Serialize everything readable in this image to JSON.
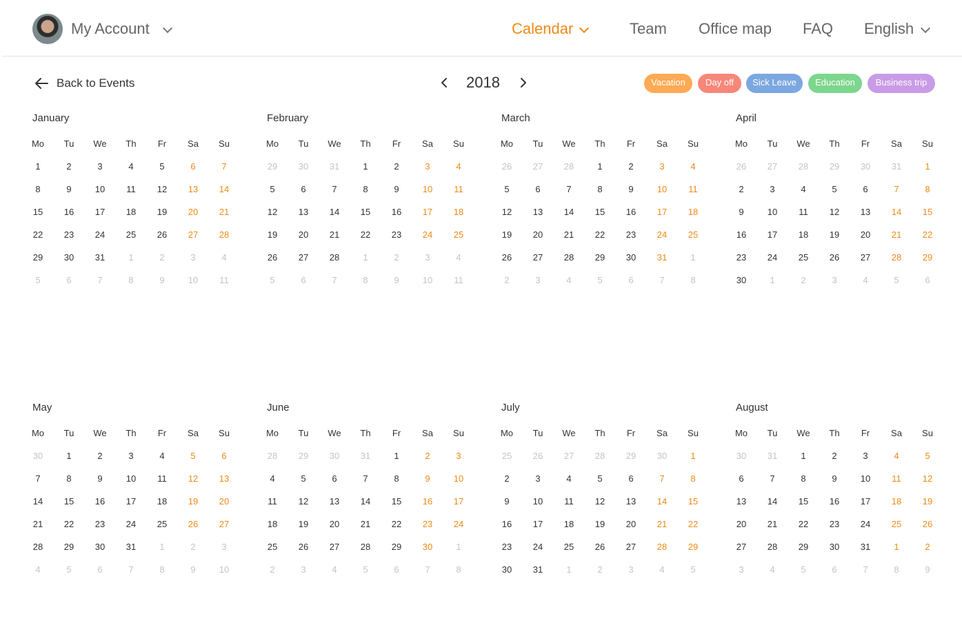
{
  "header": {
    "account_label": "My Account",
    "nav": [
      "Calendar",
      "Team",
      "Office map",
      "FAQ",
      "English"
    ],
    "active": "Calendar",
    "accent_color": "#ef8a17"
  },
  "toolbar": {
    "back_label": "Back to Events",
    "year": "2018"
  },
  "legend": [
    {
      "label": "Vacation",
      "color": "#ffaa55"
    },
    {
      "label": "Day off",
      "color": "#f7877a"
    },
    {
      "label": "Sick Leave",
      "color": "#7ba8e0"
    },
    {
      "label": "Education",
      "color": "#7dd68d"
    },
    {
      "label": "Business trip",
      "color": "#c99be6"
    }
  ],
  "weekdays": [
    "Mo",
    "Tu",
    "We",
    "Th",
    "Fr",
    "Sa",
    "Su"
  ],
  "months": [
    {
      "name": "January",
      "days": [
        1,
        2,
        3,
        4,
        5,
        6,
        7,
        8,
        9,
        10,
        11,
        12,
        13,
        14,
        15,
        16,
        17,
        18,
        19,
        20,
        21,
        22,
        23,
        24,
        25,
        26,
        27,
        28,
        29,
        30,
        31,
        1,
        2,
        3,
        4,
        5,
        6,
        7,
        8,
        9,
        10,
        11
      ],
      "lead_muted": 0,
      "trail_muted": 11
    },
    {
      "name": "February",
      "days": [
        29,
        30,
        31,
        1,
        2,
        3,
        4,
        5,
        6,
        7,
        8,
        9,
        10,
        11,
        12,
        13,
        14,
        15,
        16,
        17,
        18,
        19,
        20,
        21,
        22,
        23,
        24,
        25,
        26,
        27,
        28,
        1,
        2,
        3,
        4,
        5,
        6,
        7,
        8,
        9,
        10,
        11
      ],
      "lead_muted": 3,
      "trail_muted": 11
    },
    {
      "name": "March",
      "days": [
        26,
        27,
        28,
        1,
        2,
        3,
        4,
        5,
        6,
        7,
        8,
        9,
        10,
        11,
        12,
        13,
        14,
        15,
        16,
        17,
        18,
        19,
        20,
        21,
        22,
        23,
        24,
        25,
        26,
        27,
        28,
        29,
        30,
        31,
        1,
        2,
        3,
        4,
        5,
        6,
        7,
        8
      ],
      "lead_muted": 3,
      "trail_muted": 8
    },
    {
      "name": "April",
      "days": [
        26,
        27,
        28,
        29,
        30,
        31,
        1,
        2,
        3,
        4,
        5,
        6,
        7,
        8,
        9,
        10,
        11,
        12,
        13,
        14,
        15,
        16,
        17,
        18,
        19,
        20,
        21,
        22,
        23,
        24,
        25,
        26,
        27,
        28,
        29,
        30,
        1,
        2,
        3,
        4,
        5,
        6
      ],
      "lead_muted": 6,
      "trail_muted": 6
    },
    {
      "name": "May",
      "days": [
        30,
        1,
        2,
        3,
        4,
        5,
        6,
        7,
        8,
        9,
        10,
        11,
        12,
        13,
        14,
        15,
        16,
        17,
        18,
        19,
        20,
        21,
        22,
        23,
        24,
        25,
        26,
        27,
        28,
        29,
        30,
        31,
        1,
        2,
        3,
        4,
        5,
        6,
        7,
        8,
        9,
        10
      ],
      "lead_muted": 1,
      "trail_muted": 10
    },
    {
      "name": "June",
      "days": [
        28,
        29,
        30,
        31,
        1,
        2,
        3,
        4,
        5,
        6,
        7,
        8,
        9,
        10,
        11,
        12,
        13,
        14,
        15,
        16,
        17,
        18,
        19,
        20,
        21,
        22,
        23,
        24,
        25,
        26,
        27,
        28,
        29,
        30,
        1,
        2,
        3,
        4,
        5,
        6,
        7,
        8
      ],
      "lead_muted": 4,
      "trail_muted": 8
    },
    {
      "name": "July",
      "days": [
        25,
        26,
        27,
        28,
        29,
        30,
        1,
        2,
        3,
        4,
        5,
        6,
        7,
        8,
        9,
        10,
        11,
        12,
        13,
        14,
        15,
        16,
        17,
        18,
        19,
        20,
        21,
        22,
        23,
        24,
        25,
        26,
        27,
        28,
        29,
        30,
        31,
        1,
        2,
        3,
        4,
        5
      ],
      "lead_muted": 6,
      "trail_muted": 5
    },
    {
      "name": "August",
      "days": [
        30,
        31,
        1,
        2,
        3,
        4,
        5,
        6,
        7,
        8,
        9,
        10,
        11,
        12,
        13,
        14,
        15,
        16,
        17,
        18,
        19,
        20,
        21,
        22,
        23,
        24,
        25,
        26,
        27,
        28,
        29,
        30,
        31,
        1,
        2,
        3,
        4,
        5,
        6,
        7,
        8,
        9
      ],
      "lead_muted": 2,
      "trail_muted": 7
    }
  ]
}
